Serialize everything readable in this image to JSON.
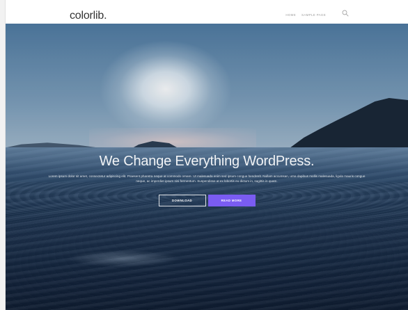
{
  "header": {
    "logo": "colorlib.",
    "nav": [
      "HOME",
      "SAMPLE PAGE"
    ],
    "search_icon": "search-icon"
  },
  "hero": {
    "title": "We Change Everything WordPress.",
    "text": "Lorem ipsum dolor sit amet, consectetur adipiscing elit. Praesent pharetra neque at commodo ornare. Ut malesuada enim sed ipsum congue hendrerit. Nullam accumsan, urna dapibus mollis malesuada, ligula mauris congue neque, ac imperdiet ipsum nisi fermentum. Suspendisse at ex lobortis eu dictum in, sagittis in quam.",
    "buttons": {
      "download": "DOWNLOAD",
      "read_more": "READ MORE"
    }
  },
  "colors": {
    "accent": "#7a5cf2",
    "logo": "#333333",
    "nav": "#a0a0a0"
  }
}
